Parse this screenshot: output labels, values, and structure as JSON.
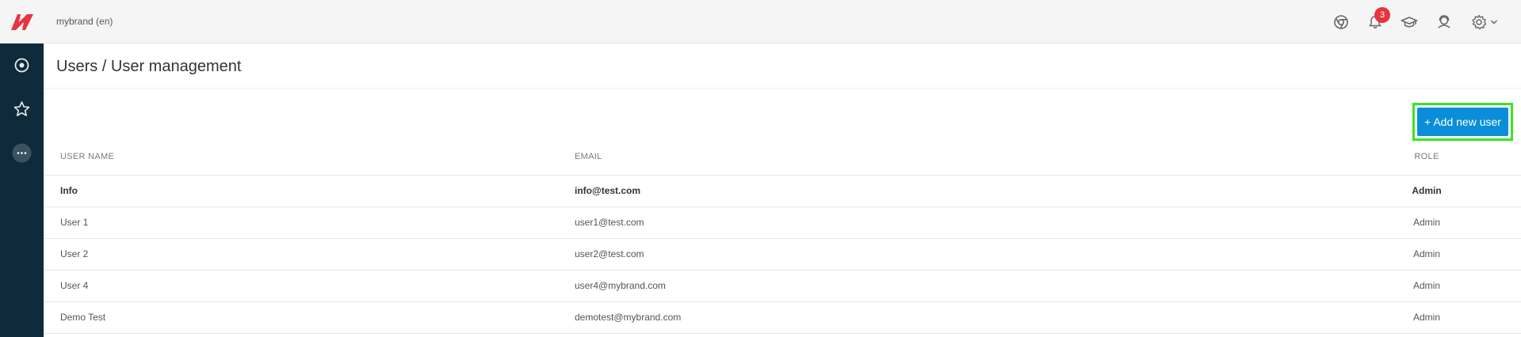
{
  "header": {
    "brand": "mybrand (en)",
    "notifications_count": "3",
    "icons": [
      "chrome-icon",
      "bell-icon",
      "graduation-cap-icon",
      "support-agent-icon",
      "gear-icon",
      "chevron-down-icon"
    ]
  },
  "sidebar": {
    "icons": [
      "dashboard-icon",
      "star-icon",
      "more-icon"
    ]
  },
  "page": {
    "title": "Users / User management",
    "add_button": "+ Add new user"
  },
  "table": {
    "headers": {
      "name": "USER NAME",
      "email": "EMAIL",
      "role": "ROLE"
    },
    "rows": [
      {
        "name": "Info",
        "email": "info@test.com",
        "role": "Admin",
        "bold": true
      },
      {
        "name": "User 1",
        "email": "user1@test.com",
        "role": "Admin"
      },
      {
        "name": "User 2",
        "email": "user2@test.com",
        "role": "Admin"
      },
      {
        "name": "User 4",
        "email": "user4@mybrand.com",
        "role": "Admin"
      },
      {
        "name": "Demo Test",
        "email": "demotest@mybrand.com",
        "role": "Admin"
      }
    ]
  },
  "colors": {
    "accent": "#0a8ed8",
    "sidebar": "#0f2a3a",
    "badge": "#e8343f",
    "logo": "#e8343f",
    "highlight": "#39e61d"
  }
}
